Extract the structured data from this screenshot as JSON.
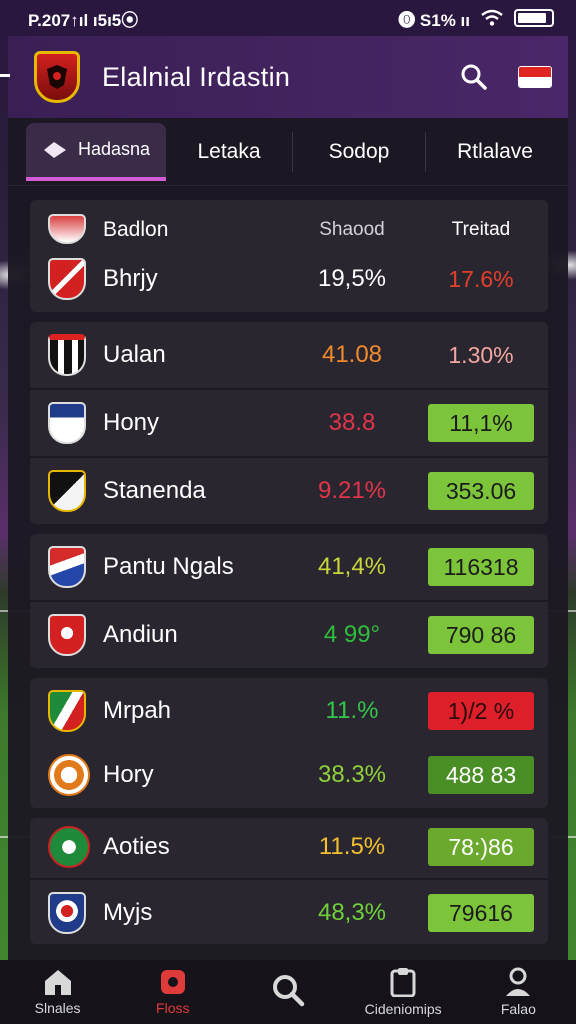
{
  "status": {
    "time": "P.207↑ıl ı5ı5⦿",
    "right": "⓿ S1% ıı"
  },
  "header": {
    "title": "Elalnial Irdastin"
  },
  "tabs": [
    {
      "label": "Hadasna",
      "active": true
    },
    {
      "label": "Letaka"
    },
    {
      "label": "Sodop"
    },
    {
      "label": "Rtlalave"
    }
  ],
  "table": {
    "header": {
      "team": "Badlon",
      "col1": "Shaood",
      "col2": "Treitad"
    },
    "rows": [
      {
        "team": "Bhrjy",
        "stat": "19,5%",
        "stat_color": "#ffffff",
        "pill": "17.6%",
        "pill_bg": "transparent",
        "pill_color": "#e3402b"
      },
      {
        "team": "Ualan",
        "stat": "41.08",
        "stat_color": "#f28a2c",
        "pill": "1.30%",
        "pill_bg": "transparent",
        "pill_color": "#f2a6a0"
      },
      {
        "team": "Hony",
        "stat": "38.8",
        "stat_color": "#e0354a",
        "pill": "11,1%",
        "pill_bg": "#7cc43a",
        "pill_color": "#1a1a1a"
      },
      {
        "team": "Stanenda",
        "stat": "9.21%",
        "stat_color": "#e0354a",
        "pill": "353.06",
        "pill_bg": "#7cc43a",
        "pill_color": "#1a1a1a"
      },
      {
        "team": "Pantu Ngals",
        "stat": "41,4%",
        "stat_color": "#c8d63a",
        "pill": "116318",
        "pill_bg": "#7cc43a",
        "pill_color": "#1a1a1a"
      },
      {
        "team": "Andiun",
        "stat": "4 99°",
        "stat_color": "#2fbf3c",
        "pill": "790 86",
        "pill_bg": "#7cc43a",
        "pill_color": "#1a1a1a"
      },
      {
        "team": "Mrpah",
        "stat": "11.%",
        "stat_color": "#33c84a",
        "pill": "1)/2 %",
        "pill_bg": "#dd1f2a",
        "pill_color": "#2a0a0a"
      },
      {
        "team": "Hory",
        "stat": "38.3%",
        "stat_color": "#8fd13a",
        "pill": "488 83",
        "pill_bg": "#4a8f26",
        "pill_color": "#ffffff"
      },
      {
        "team": "Aoties",
        "stat": "11.5%",
        "stat_color": "#f2c02e",
        "pill": "78:)86",
        "pill_bg": "#6ba92e",
        "pill_color": "#ffffff"
      },
      {
        "team": "Myjs",
        "stat": "48,3%",
        "stat_color": "#6ed13a",
        "pill": "79616",
        "pill_bg": "#7cc43a",
        "pill_color": "#1a1a1a"
      }
    ]
  },
  "nav": [
    {
      "label": "Slnales",
      "icon": "home-icon"
    },
    {
      "label": "Floss",
      "icon": "record-icon",
      "active": true
    },
    {
      "label": "",
      "icon": "search-icon"
    },
    {
      "label": "Cideniomips",
      "icon": "clipboard-icon"
    },
    {
      "label": "Falao",
      "icon": "profile-icon"
    }
  ],
  "colors": {
    "accent": "#d35bd6",
    "header_bg": "#3a1f55",
    "panel_bg": "#1c1822",
    "row_bg": "#2a2630"
  }
}
